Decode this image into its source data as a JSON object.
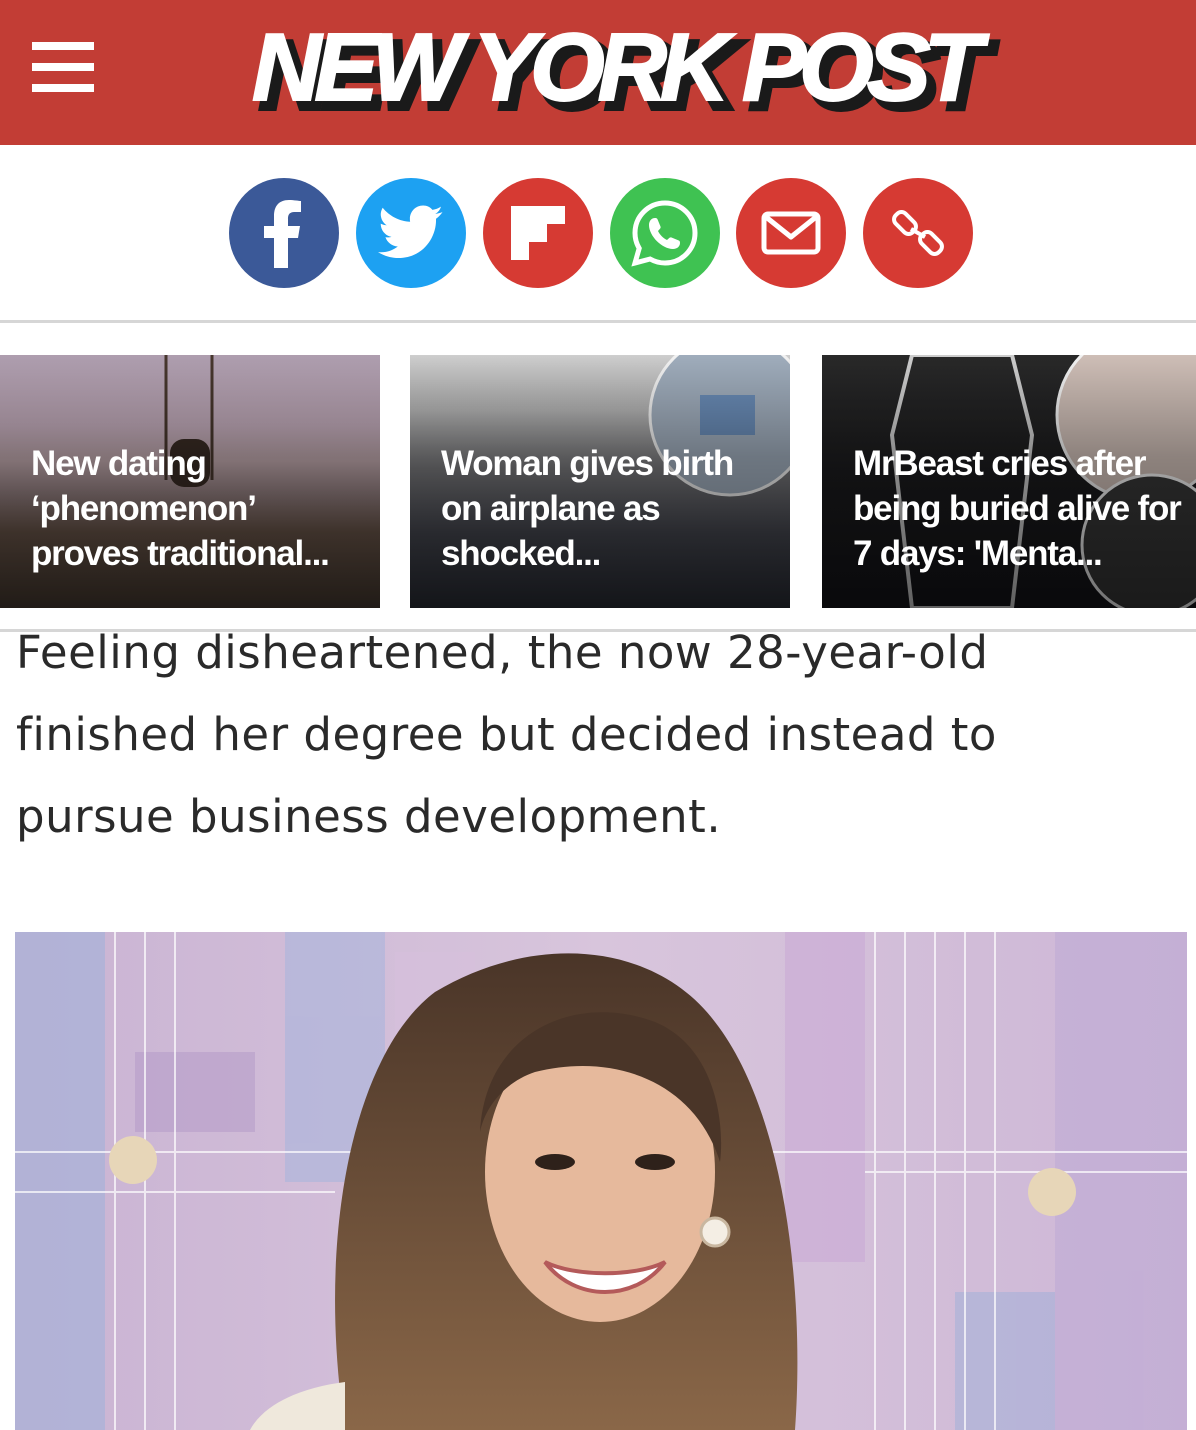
{
  "header": {
    "logo_text": "NEW YORK POST",
    "background_color": "#c23d35"
  },
  "share": {
    "buttons": [
      {
        "name": "facebook",
        "icon": "facebook-icon",
        "color": "#3b5998"
      },
      {
        "name": "twitter",
        "icon": "twitter-icon",
        "color": "#1da1f2"
      },
      {
        "name": "flipboard",
        "icon": "flipboard-icon",
        "color": "#d63a33"
      },
      {
        "name": "whatsapp",
        "icon": "whatsapp-icon",
        "color": "#3fc252"
      },
      {
        "name": "email",
        "icon": "email-icon",
        "color": "#d63a33"
      },
      {
        "name": "copy-link",
        "icon": "link-icon",
        "color": "#d63a33"
      }
    ]
  },
  "related": [
    {
      "title": "New dating ‘phenomenon’ proves traditional..."
    },
    {
      "title": "Woman gives birth on airplane as shocked..."
    },
    {
      "title": "MrBeast cries after being buried alive for 7 days: 'Menta..."
    }
  ],
  "article": {
    "lines": [
      "Feeling disheartened, the now 28-year-old",
      "finished her degree but decided instead to",
      "pursue business development."
    ]
  }
}
